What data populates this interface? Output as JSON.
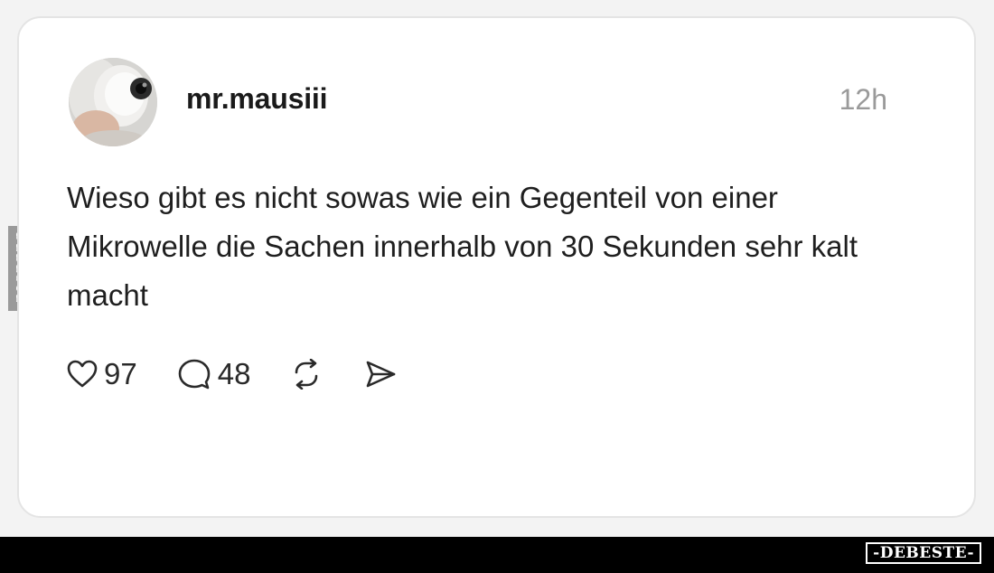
{
  "post": {
    "username": "mr.mausiii",
    "time": "12h",
    "text": "Wieso gibt es nicht sowas wie ein Gegenteil von einer Mikrowelle die Sachen innerhalb von 30 Sekunden sehr kalt macht",
    "likes": "97",
    "comments": "48"
  },
  "icons": {
    "like": "heart-icon",
    "comment": "comment-bubble-icon",
    "repost": "repost-icon",
    "share": "send-icon"
  },
  "watermark": {
    "side": "DEBESTE",
    "footer": "-DEBESTE-"
  },
  "colors": {
    "card_background": "#ffffff",
    "page_background": "#f3f3f3",
    "text": "#1f1f1f",
    "muted": "#9a9a9a",
    "footer": "#000000"
  }
}
